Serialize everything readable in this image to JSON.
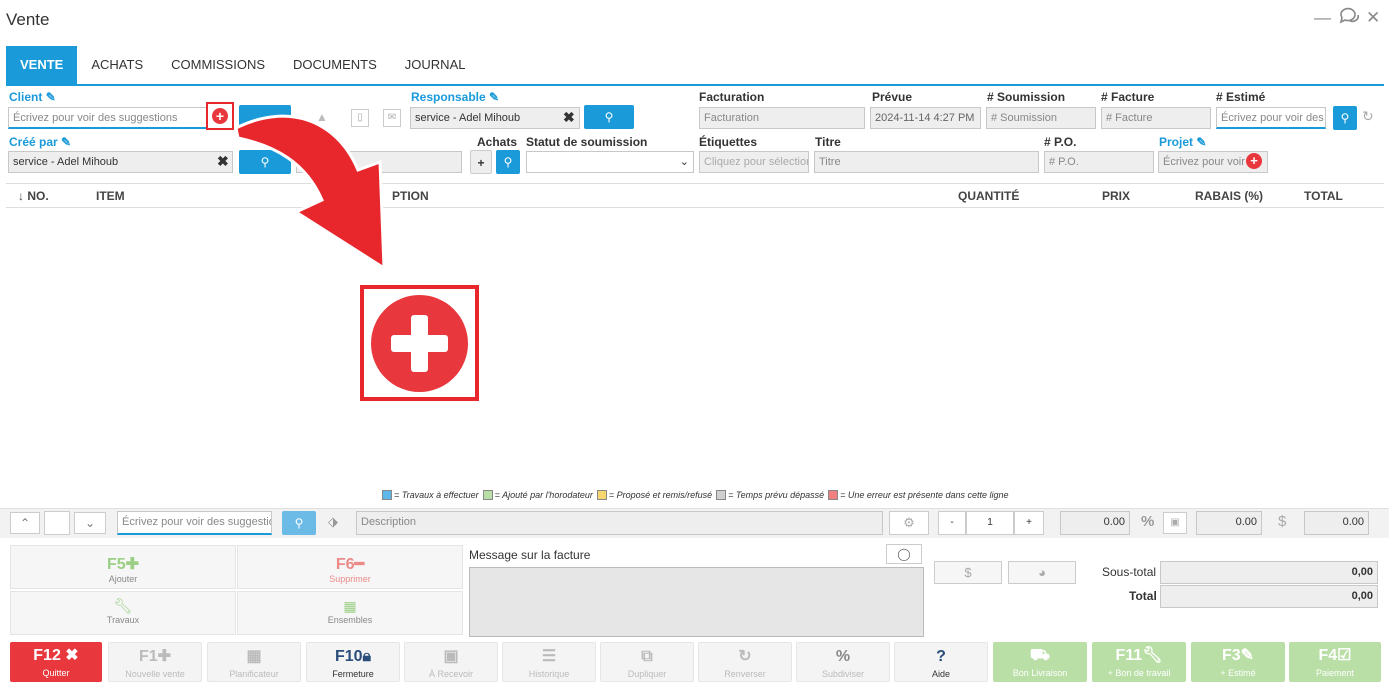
{
  "window": {
    "title": "Vente",
    "minimize_icon": "minimize-icon",
    "chat_icon": "chat-icon",
    "close_icon": "close-icon"
  },
  "tabs": [
    {
      "label": "VENTE",
      "active": true
    },
    {
      "label": "ACHATS"
    },
    {
      "label": "COMMISSIONS"
    },
    {
      "label": "DOCUMENTS"
    },
    {
      "label": "JOURNAL"
    }
  ],
  "form": {
    "client_label": "Client",
    "client_placeholder": "Écrivez pour voir des suggestions",
    "responsable_label": "Responsable",
    "responsable_value": "service - Adel Mihoub",
    "facturation_label": "Facturation",
    "facturation_placeholder": "Facturation",
    "prevue_label": "Prévue",
    "prevue_value": "2024-11-14 4:27 PM",
    "soumission_label": "# Soumission",
    "soumission_placeholder": "# Soumission",
    "facture_label": "# Facture",
    "facture_placeholder": "# Facture",
    "estime_label": "# Estimé",
    "estime_placeholder": "Écrivez pour voir des s",
    "cree_par_label": "Créé par",
    "cree_par_value": "service - Adel Mihoub",
    "achats_label": "Achats",
    "statut_label": "Statut de soumission",
    "etiquettes_label": "Étiquettes",
    "etiquettes_placeholder": "Cliquez pour sélection",
    "titre_label": "Titre",
    "titre_placeholder": "Titre",
    "po_label": "# P.O.",
    "po_placeholder": "# P.O.",
    "projet_label": "Projet",
    "projet_placeholder": "Écrivez pour voir d"
  },
  "table": {
    "col_no": "↓ NO.",
    "col_item": "ITEM",
    "col_description": "PTION",
    "col_quantite": "QUANTITÉ",
    "col_prix": "PRIX",
    "col_rabais": "RABAIS (%)",
    "col_total": "TOTAL"
  },
  "legend": {
    "l1": "= Travaux à effectuer",
    "l2": "= Ajouté par l'horodateur",
    "l3": "= Proposé et remis/refusé",
    "l4": "= Temps prévu dépassé",
    "l5": "= Une erreur est présente dans cette ligne",
    "colors": {
      "blue": "#5bb8e8",
      "green": "#b9dfa7",
      "yellow": "#f5d76e",
      "gray": "#cfcfcf",
      "red": "#f08080"
    }
  },
  "entry": {
    "item_placeholder": "Écrivez pour voir des suggestion",
    "description_placeholder": "Description",
    "qty_minus": "-",
    "qty_value": "1",
    "qty_plus": "+",
    "price_value": "0.00",
    "percent_symbol": "%",
    "discount_value": "0.00",
    "dollar_symbol": "$",
    "total_value": "0.00"
  },
  "actions": {
    "f5_key": "F5",
    "f5_label": "Ajouter",
    "f6_key": "F6",
    "f6_label": "Supprimer",
    "travaux_label": "Travaux",
    "ensembles_label": "Ensembles"
  },
  "message": {
    "label": "Message sur la facture"
  },
  "totals": {
    "dollar_symbol": "$",
    "sous_total_label": "Sous-total",
    "sous_total_value": "0,00",
    "total_label": "Total",
    "total_value": "0,00"
  },
  "bottom": [
    {
      "key": "F12",
      "label": "Quitter",
      "style": "red"
    },
    {
      "key": "F1",
      "label": "Nouvelle vente",
      "style": "gray"
    },
    {
      "key": "",
      "label": "Planificateur",
      "style": "gray"
    },
    {
      "key": "F10",
      "label": "Fermeture",
      "style": "active"
    },
    {
      "key": "",
      "label": "À Recevoir",
      "style": "gray"
    },
    {
      "key": "",
      "label": "Historique",
      "style": "gray"
    },
    {
      "key": "",
      "label": "Dupliquer",
      "style": "gray"
    },
    {
      "key": "",
      "label": "Renverser",
      "style": "gray"
    },
    {
      "key": "%",
      "label": "Subdiviser",
      "style": "gray"
    },
    {
      "key": "?",
      "label": "Aide",
      "style": "active"
    },
    {
      "key": "",
      "label": "Bon Livraison",
      "style": "green"
    },
    {
      "key": "F11",
      "label": "+ Bon de travail",
      "style": "green"
    },
    {
      "key": "F3",
      "label": "+ Estimé",
      "style": "green"
    },
    {
      "key": "F4",
      "label": "Paiement",
      "style": "green"
    }
  ],
  "accent": "#1a9ad9",
  "annotation_color": "#e8272d"
}
